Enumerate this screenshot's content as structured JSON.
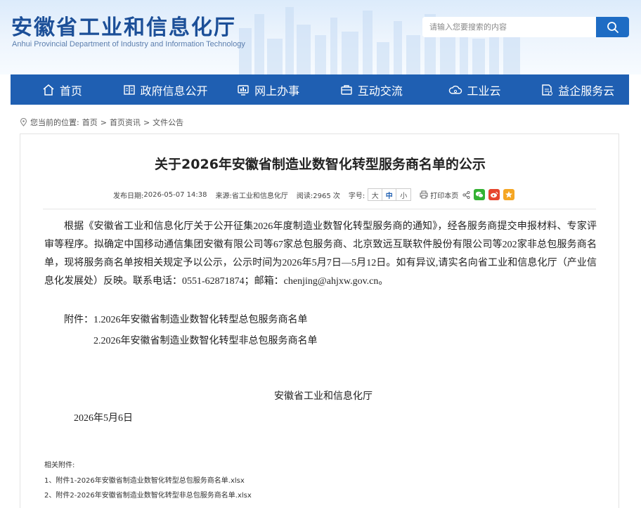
{
  "header": {
    "title": "安徽省工业和信息化厅",
    "subtitle": "Anhui Provincial Department of Industry and Information Technology",
    "search_placeholder": "请输入您要搜索的内容"
  },
  "nav": [
    {
      "label": "首页",
      "icon": "home-icon"
    },
    {
      "label": "政府信息公开",
      "icon": "book-icon"
    },
    {
      "label": "网上办事",
      "icon": "monitor-icon"
    },
    {
      "label": "互动交流",
      "icon": "briefcase-icon"
    },
    {
      "label": "工业云",
      "icon": "cloud-icon"
    },
    {
      "label": "益企服务云",
      "icon": "document-icon"
    }
  ],
  "breadcrumb": {
    "prefix": "您当前的位置:",
    "items": [
      "首页",
      "首页资讯",
      "文件公告"
    ],
    "separator": ">"
  },
  "article": {
    "title": "关于2026年安徽省制造业数智化转型服务商名单的公示",
    "meta": {
      "date_label": "发布日期:",
      "date": "2026-05-07 14:38",
      "source_label": "来源:",
      "source": "省工业和信息化厅",
      "views_label": "阅读:",
      "views": "2965 次",
      "fontsize_label": "字号:",
      "font_sizes": [
        "大",
        "中",
        "小"
      ],
      "print_label": "打印本页"
    },
    "body": "根据《安徽省工业和信息化厅关于公开征集2026年度制造业数智化转型服务商的通知》，经各服务商提交申报材料、专家评审等程序。拟确定中国移动通信集团安徽有限公司等67家总包服务商、北京致远互联软件股份有限公司等202家非总包服务商名单，现将服务商名单按相关规定予以公示，公示时间为2026年5月7日—5月12日。如有异议,请实名向省工业和信息化厅（产业信息化发展处）反映。联系电话：0551-62871874；邮箱：chenjing@ahjxw.gov.cn。",
    "attachments_label": "附件：",
    "attachment_1": "1.2026年安徽省制造业数智化转型总包服务商名单",
    "attachment_2": "2.2026年安徽省制造业数智化转型非总包服务商名单",
    "signature": "安徽省工业和信息化厅",
    "sign_date": "2026年5月6日",
    "related_label": "相关附件:",
    "related_files": [
      "1、附件1-2026年安徽省制造业数智化转型总包服务商名单.xlsx",
      "2、附件2-2026年安徽省制造业数智化转型非总包服务商名单.xlsx"
    ]
  },
  "colors": {
    "nav_bg": "#1f5fb2",
    "title_blue": "#1c4f98",
    "search_btn": "#1e6cc4",
    "wechat": "#34b233",
    "weibo": "#e6452e",
    "qzone": "#f5a623"
  }
}
